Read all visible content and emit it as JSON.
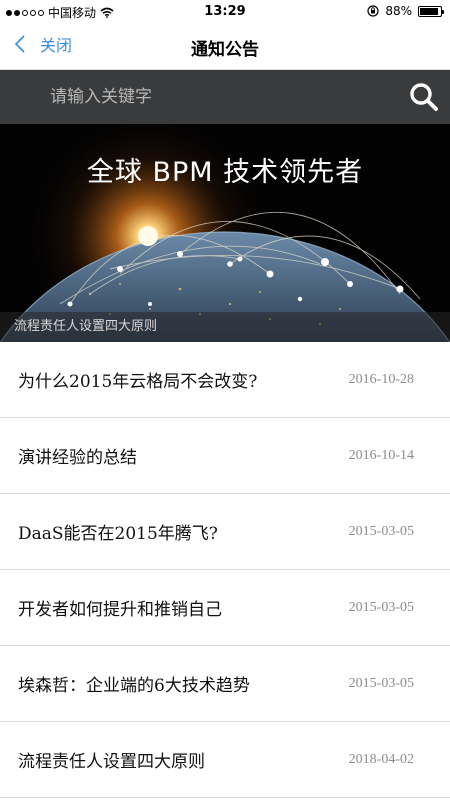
{
  "status_bar": {
    "carrier": "中国移动",
    "time": "13:29",
    "battery": "88%",
    "battery_level": 0.88
  },
  "nav": {
    "back_label": "关闭",
    "title": "通知公告"
  },
  "search": {
    "placeholder": "请输入关键字"
  },
  "banner": {
    "title": "全球 BPM 技术领先者",
    "caption": "流程责任人设置四大原则"
  },
  "news": [
    {
      "title": "为什么2015年云格局不会改变?",
      "date": "2016-10-28"
    },
    {
      "title": "演讲经验的总结",
      "date": "2016-10-14"
    },
    {
      "title": "DaaS能否在2015年腾飞?",
      "date": "2015-03-05"
    },
    {
      "title": "开发者如何提升和推销自己",
      "date": "2015-03-05"
    },
    {
      "title": "埃森哲：企业端的6大技术趋势",
      "date": "2015-03-05"
    },
    {
      "title": "流程责任人设置四大原则",
      "date": "2018-04-02"
    }
  ],
  "colors": {
    "accent": "#3a8ee6",
    "search_bg": "#3a3b3d",
    "date_text": "#8c8c8c"
  }
}
